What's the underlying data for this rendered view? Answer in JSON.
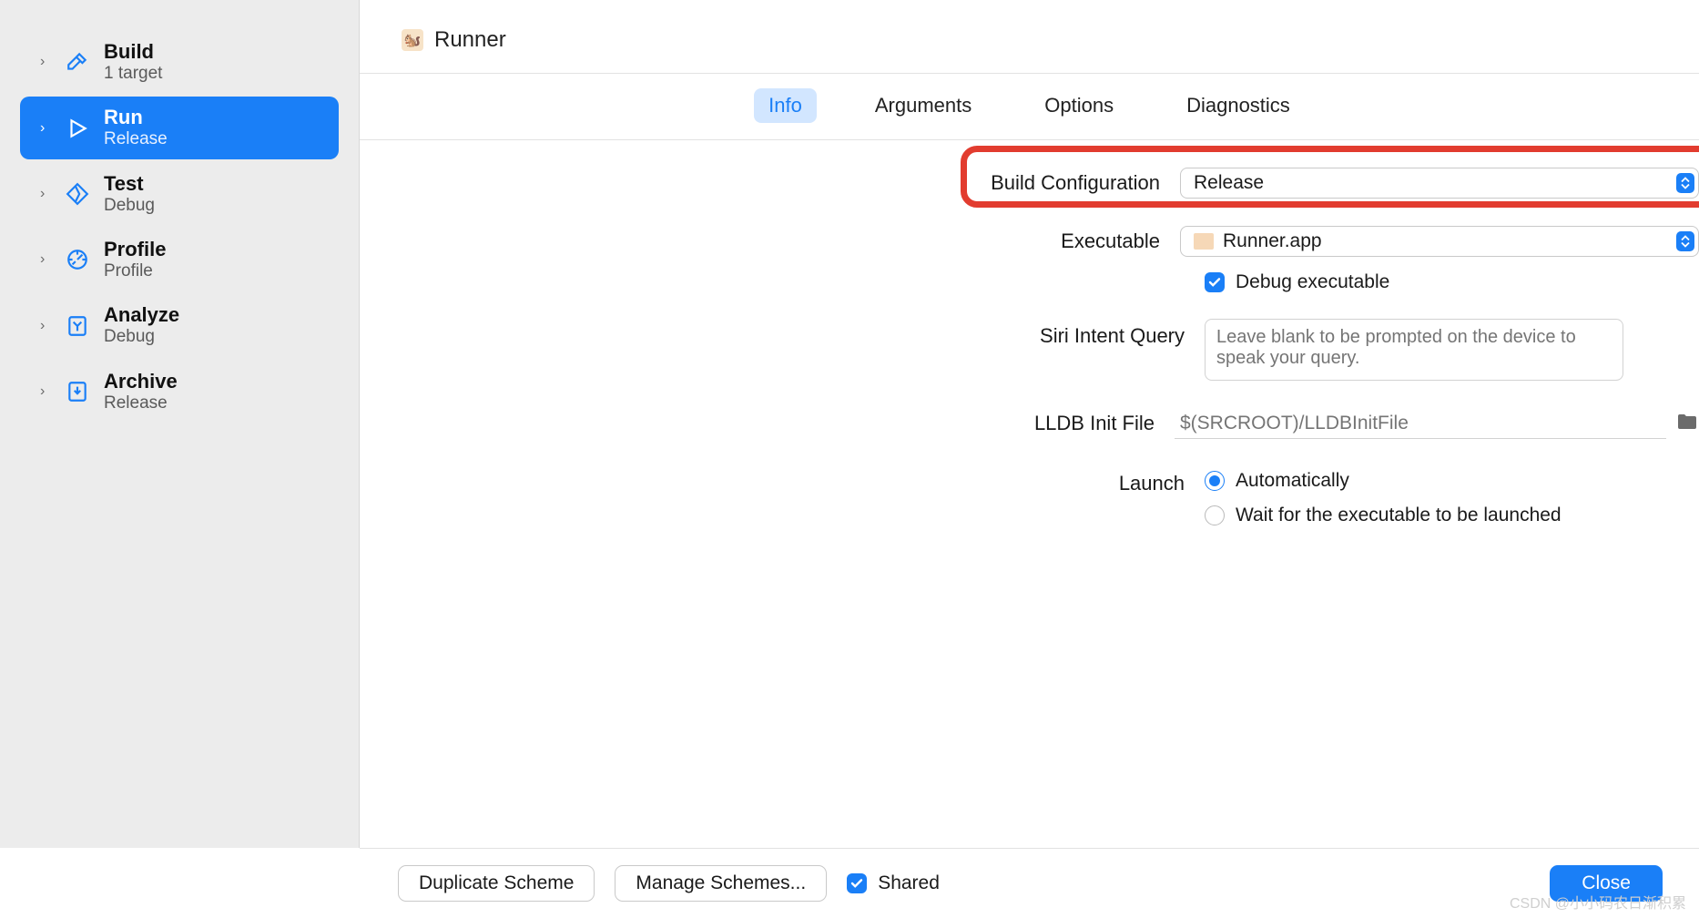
{
  "sidebar": {
    "items": [
      {
        "title": "Build",
        "sub": "1 target"
      },
      {
        "title": "Run",
        "sub": "Release"
      },
      {
        "title": "Test",
        "sub": "Debug"
      },
      {
        "title": "Profile",
        "sub": "Profile"
      },
      {
        "title": "Analyze",
        "sub": "Debug"
      },
      {
        "title": "Archive",
        "sub": "Release"
      }
    ]
  },
  "header": {
    "scheme_name": "Runner"
  },
  "tabs": {
    "items": [
      "Info",
      "Arguments",
      "Options",
      "Diagnostics"
    ],
    "active_index": 0
  },
  "form": {
    "build_config": {
      "label": "Build Configuration",
      "value": "Release"
    },
    "executable": {
      "label": "Executable",
      "value": "Runner.app"
    },
    "debug_exec": {
      "label": "Debug executable",
      "checked": true
    },
    "siri_query": {
      "label": "Siri Intent Query",
      "placeholder": "Leave blank to be prompted on the device to speak your query."
    },
    "lldb_init": {
      "label": "LLDB Init File",
      "placeholder": "$(SRCROOT)/LLDBInitFile"
    },
    "launch": {
      "label": "Launch",
      "auto": "Automatically",
      "wait": "Wait for the executable to be launched",
      "selected": "auto"
    }
  },
  "footer": {
    "duplicate": "Duplicate Scheme",
    "manage": "Manage Schemes...",
    "shared": {
      "label": "Shared",
      "checked": true
    },
    "close": "Close"
  },
  "watermark": "CSDN @小小码农日渐积累"
}
